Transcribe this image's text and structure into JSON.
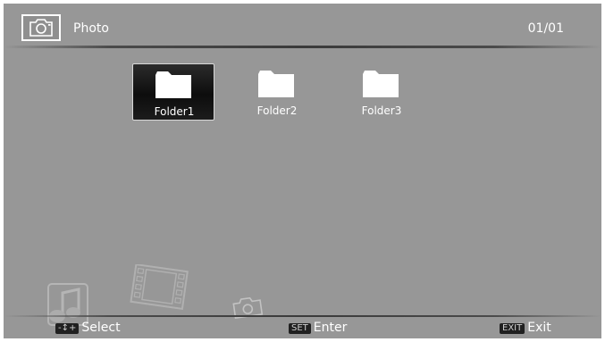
{
  "header": {
    "title": "Photo",
    "page_indicator": "01/01"
  },
  "folders": [
    {
      "label": "Folder1",
      "selected": true
    },
    {
      "label": "Folder2",
      "selected": false
    },
    {
      "label": "Folder3",
      "selected": false
    }
  ],
  "footer": {
    "select": {
      "key": "-↕+",
      "label": "Select"
    },
    "enter": {
      "key": "SET",
      "label": "Enter"
    },
    "exit": {
      "key": "EXIT",
      "label": "Exit"
    }
  },
  "colors": {
    "background": "#979797",
    "text": "#ffffff",
    "selection": "#111111"
  },
  "icons": {
    "header": "camera-icon",
    "folder": "folder-icon",
    "watermarks": [
      "music-icon",
      "film-icon",
      "camera-icon"
    ]
  }
}
